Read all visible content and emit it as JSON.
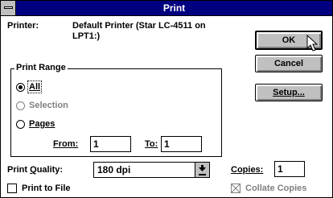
{
  "window": {
    "title": "Print",
    "sysmenu_icon": "system-menu-icon"
  },
  "printer": {
    "label": "Printer:",
    "name": "Default Printer (Star LC-4511 on",
    "name_line2": "LPT1:)"
  },
  "buttons": {
    "ok": "OK",
    "cancel": "Cancel",
    "setup": "Setup..."
  },
  "print_range": {
    "legend": "Print Range",
    "all": "All",
    "selection": "Selection",
    "pages": "Pages",
    "selected": "All",
    "from_label": "From:",
    "from_value": "1",
    "to_label": "To:",
    "to_value": "1"
  },
  "quality": {
    "label": "Print Quality:",
    "value": "180 dpi"
  },
  "copies": {
    "label": "Copies:",
    "value": "1"
  },
  "print_to_file": {
    "label": "Print to File",
    "checked": false
  },
  "collate": {
    "label": "Collate Copies",
    "enabled": false
  }
}
